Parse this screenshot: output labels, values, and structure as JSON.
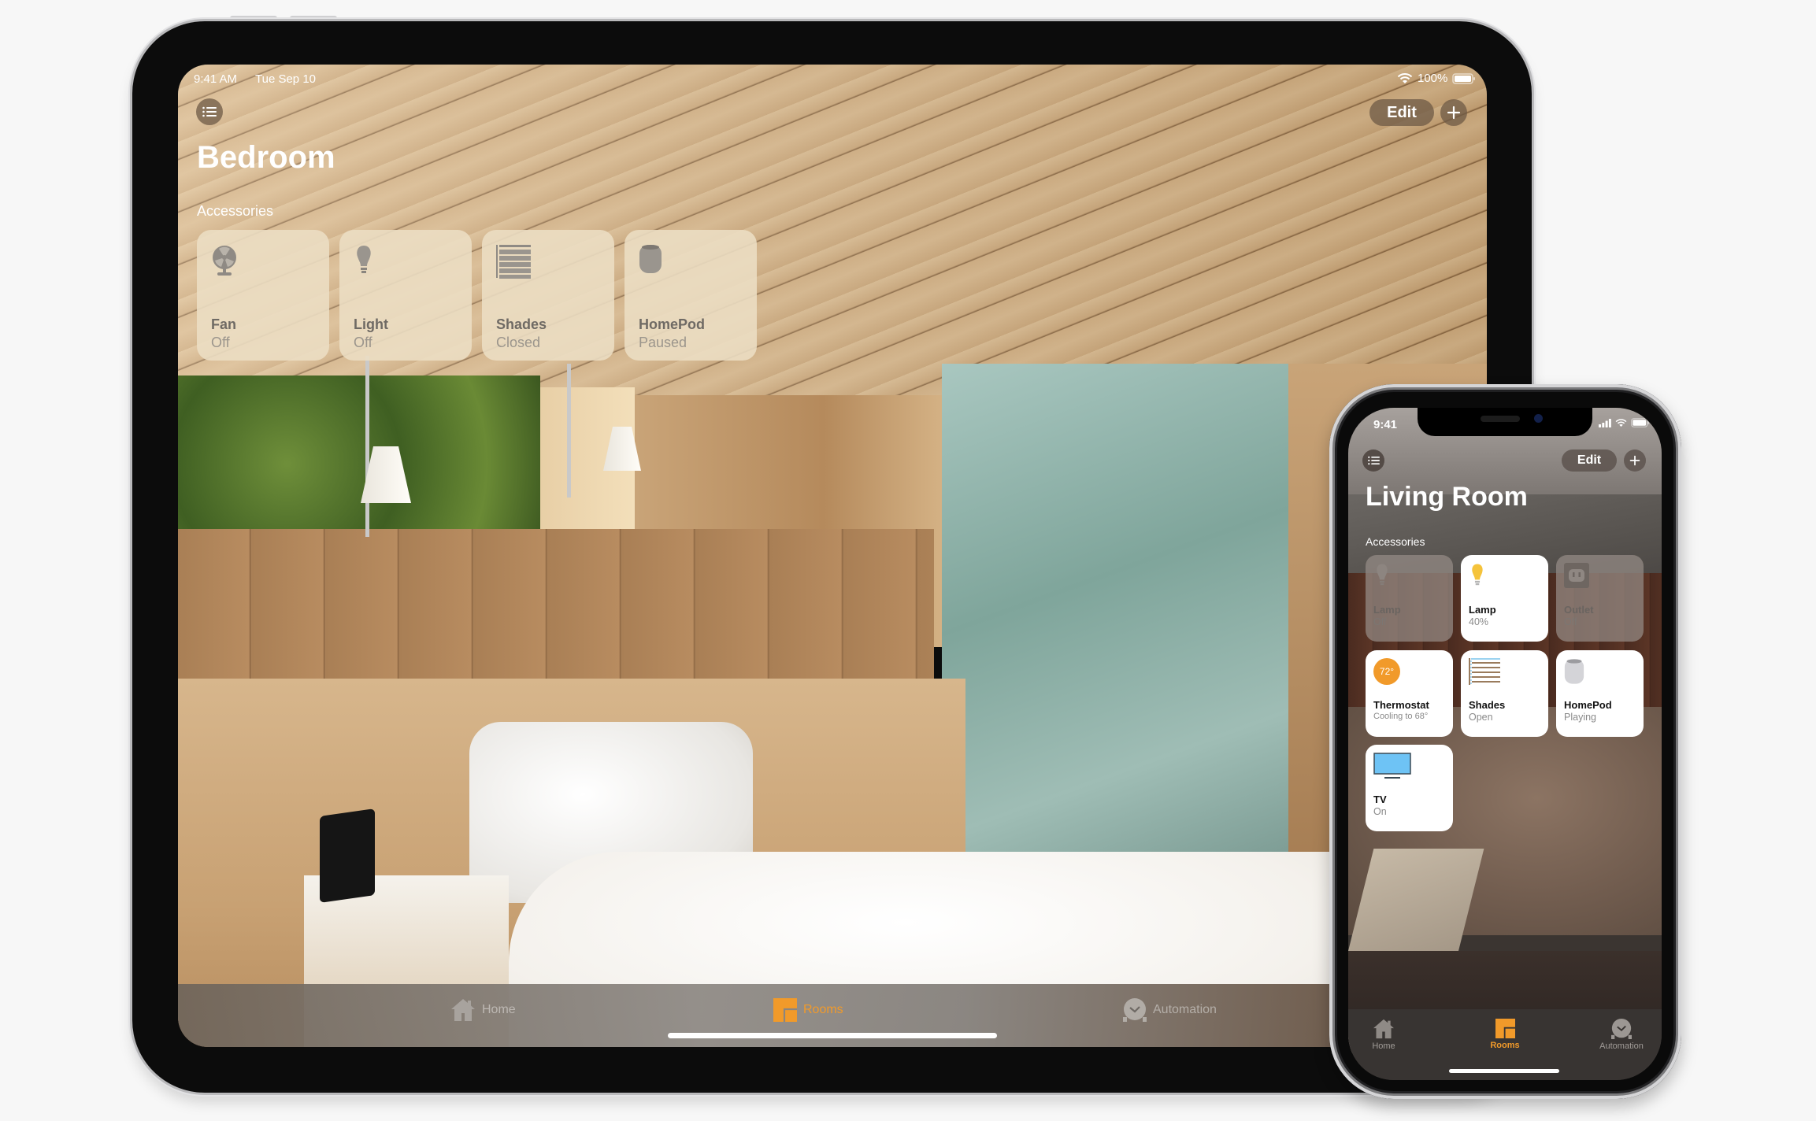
{
  "ipad": {
    "status": {
      "time": "9:41 AM",
      "date": "Tue Sep 10",
      "battery": "100%",
      "wifi_icon": "wifi-icon",
      "battery_icon": "battery-icon"
    },
    "toolbar": {
      "menu_icon": "list-icon",
      "edit_label": "Edit",
      "add_icon": "plus-icon"
    },
    "title": "Bedroom",
    "section_label": "Accessories",
    "accessories": [
      {
        "name": "Fan",
        "status": "Off",
        "icon": "fan-icon"
      },
      {
        "name": "Light",
        "status": "Off",
        "icon": "lightbulb-icon"
      },
      {
        "name": "Shades",
        "status": "Closed",
        "icon": "shades-icon"
      },
      {
        "name": "HomePod",
        "status": "Paused",
        "icon": "homepod-icon"
      }
    ],
    "tabs": [
      {
        "label": "Home",
        "icon": "house-icon",
        "active": false
      },
      {
        "label": "Rooms",
        "icon": "rooms-icon",
        "active": true
      },
      {
        "label": "Automation",
        "icon": "clock-check-icon",
        "active": false
      }
    ]
  },
  "iphone": {
    "status": {
      "time": "9:41",
      "signal_icon": "cellular-signal-icon",
      "wifi_icon": "wifi-icon",
      "battery_icon": "battery-icon"
    },
    "toolbar": {
      "menu_icon": "list-icon",
      "edit_label": "Edit",
      "add_icon": "plus-icon"
    },
    "title": "Living Room",
    "section_label": "Accessories",
    "accessories": [
      {
        "name": "Lamp",
        "status": "Off",
        "icon": "lightbulb-icon",
        "on": false
      },
      {
        "name": "Lamp",
        "status": "40%",
        "icon": "lightbulb-icon",
        "on": true
      },
      {
        "name": "Outlet",
        "status": "Off",
        "icon": "outlet-icon",
        "on": false
      },
      {
        "name": "Thermostat",
        "status": "Cooling to 68°",
        "icon": "thermostat-icon",
        "badge": "72°",
        "on": true
      },
      {
        "name": "Shades",
        "status": "Open",
        "icon": "shades-icon",
        "on": true
      },
      {
        "name": "HomePod",
        "status": "Playing",
        "icon": "homepod-icon",
        "on": true
      },
      {
        "name": "TV",
        "status": "On",
        "icon": "tv-icon",
        "on": true
      }
    ],
    "tabs": [
      {
        "label": "Home",
        "icon": "house-icon",
        "active": false
      },
      {
        "label": "Rooms",
        "icon": "rooms-icon",
        "active": true
      },
      {
        "label": "Automation",
        "icon": "clock-check-icon",
        "active": false
      }
    ]
  },
  "colors": {
    "accent": "#f19a2a",
    "bulb_on": "#f5c33b",
    "thermostat": "#f19a2a",
    "tv_screen": "#6ec3f5"
  }
}
